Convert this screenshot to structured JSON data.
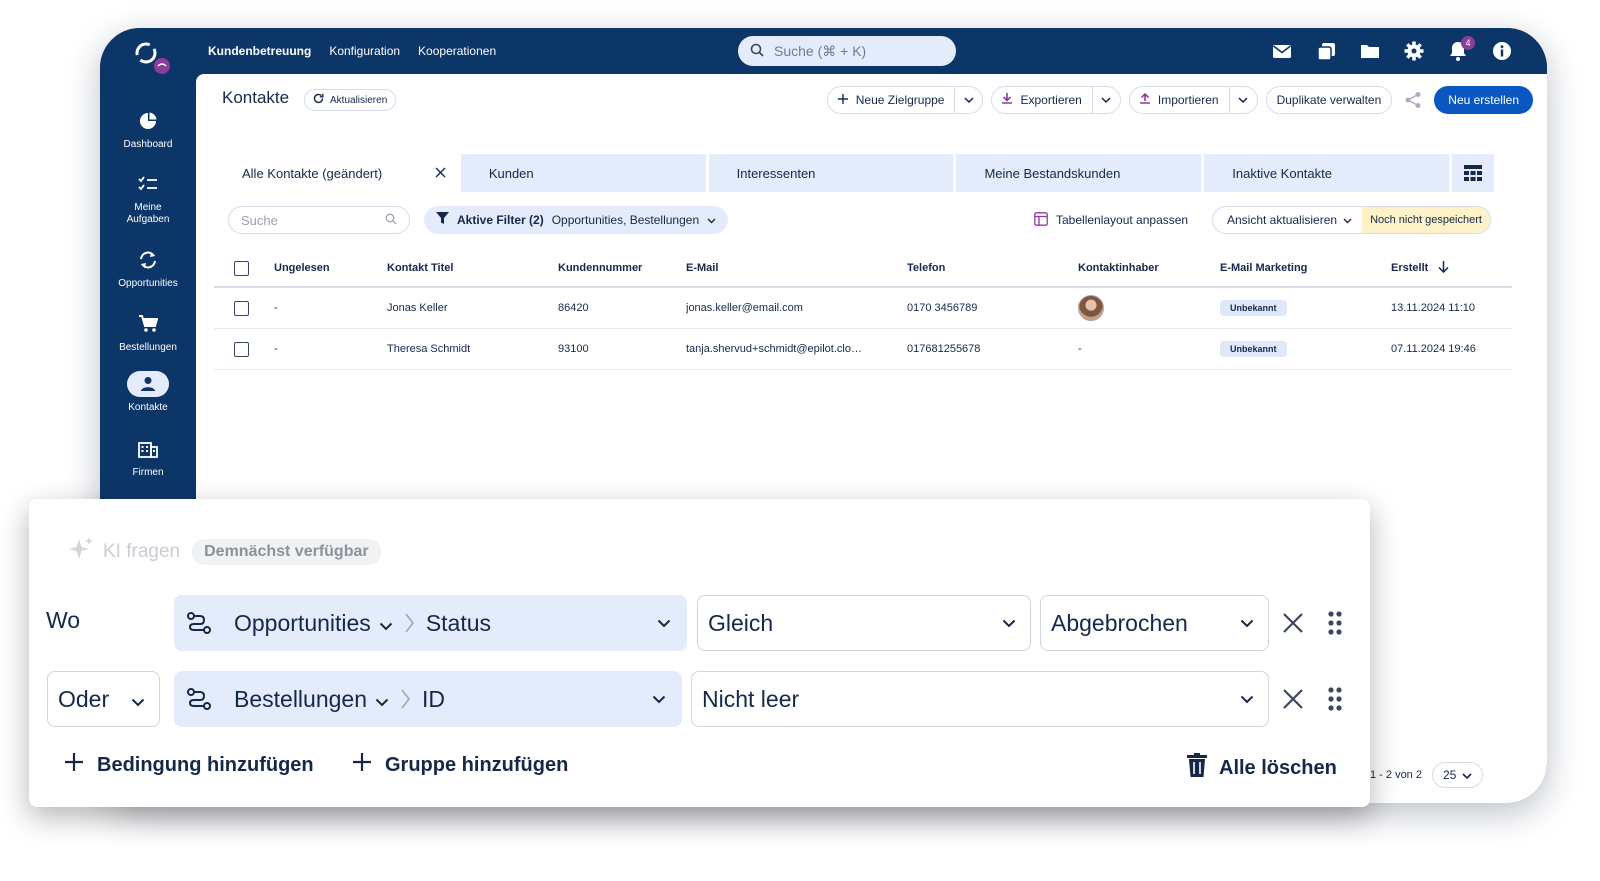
{
  "topbar": {
    "nav": [
      "Kundenbetreuung",
      "Konfiguration",
      "Kooperationen"
    ],
    "search_placeholder": "Suche (⌘ + K)",
    "notifications_count": "4",
    "icons": [
      "mail-icon",
      "copy-icon",
      "folder-icon",
      "gear-icon",
      "bell-icon",
      "info-icon"
    ]
  },
  "sidebar": {
    "items": [
      {
        "label": "Dashboard",
        "icon": "pie-chart-icon"
      },
      {
        "label": "Meine Aufgaben",
        "icon": "checklist-icon"
      },
      {
        "label": "Opportunities",
        "icon": "sync-icon"
      },
      {
        "label": "Bestellungen",
        "icon": "cart-icon"
      },
      {
        "label": "Kontakte",
        "icon": "person-icon",
        "active": true
      },
      {
        "label": "Firmen",
        "icon": "building-icon"
      }
    ]
  },
  "header": {
    "title": "Kontakte",
    "refresh_label": "Aktualisieren",
    "neue_zielgruppe": "Neue Zielgruppe",
    "exportieren": "Exportieren",
    "importieren": "Importieren",
    "duplikate": "Duplikate verwalten",
    "neu_erstellen": "Neu erstellen"
  },
  "tabs": [
    "Alle Kontakte (geändert)",
    "Kunden",
    "Interessenten",
    "Meine Bestandskunden",
    "Inaktive Kontakte"
  ],
  "filterbar": {
    "search_placeholder": "Suche",
    "filter_bold": "Aktive Filter (2)",
    "filter_rest": "Opportunities, Bestellungen",
    "layout_label": "Tabellenlayout anpassen",
    "view_label": "Ansicht aktualisieren",
    "unsaved_label": "Noch nicht gespeichert"
  },
  "table": {
    "columns": [
      "Ungelesen",
      "Kontakt Titel",
      "Kundennummer",
      "E-Mail",
      "Telefon",
      "Kontaktinhaber",
      "E-Mail Marketing",
      "Erstellt"
    ],
    "rows": [
      {
        "ungelesen": "-",
        "titel": "Jonas Keller",
        "nummer": "86420",
        "email": "jonas.keller@email.com",
        "telefon": "0170 3456789",
        "inhaber": "",
        "marketing": "Unbekannt",
        "erstellt": "13.11.2024 11:10"
      },
      {
        "ungelesen": "-",
        "titel": "Theresa Schmidt",
        "nummer": "93100",
        "email": "tanja.shervud+schmidt@epilot.clo…",
        "telefon": "017681255678",
        "inhaber": "-",
        "marketing": "Unbekannt",
        "erstellt": "07.11.2024 19:46"
      }
    ]
  },
  "pager": {
    "range": "1 - 2 von 2",
    "page_size": "25"
  },
  "filter_panel": {
    "ki_label": "KI fragen",
    "ki_badge": "Demnächst verfügbar",
    "row1": {
      "prefix": "Wo",
      "entity": "Opportunities",
      "field": "Status",
      "operator": "Gleich",
      "value": "Abgebrochen"
    },
    "row2": {
      "prefix": "Oder",
      "entity": "Bestellungen",
      "field": "ID",
      "operator": "Nicht leer"
    },
    "add_condition": "Bedingung hinzufügen",
    "add_group": "Gruppe hinzufügen",
    "delete_all": "Alle löschen"
  },
  "colors": {
    "navy": "#0d3668",
    "primary": "#0a57c2",
    "light_blue": "#e4ecfb",
    "unsaved": "#fdf2c8",
    "badge": "#8e3c9c"
  }
}
